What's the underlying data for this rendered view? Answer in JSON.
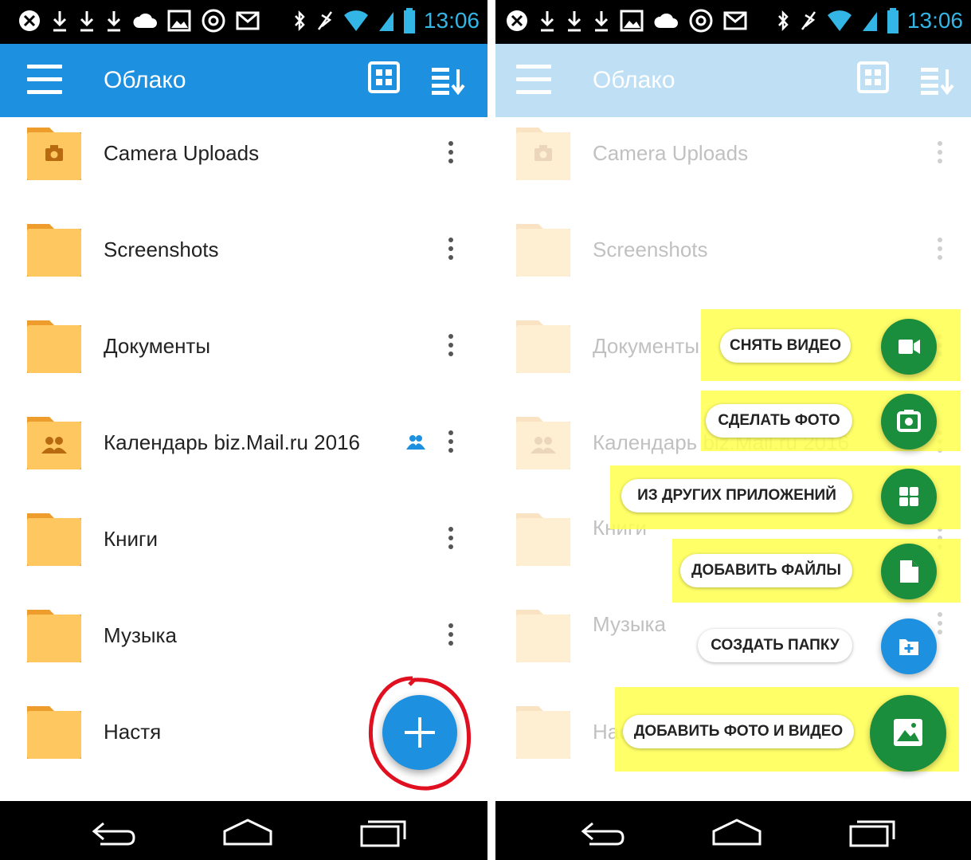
{
  "status_bar": {
    "time": "13:06"
  },
  "app_bar": {
    "title": "Облако"
  },
  "folders": [
    {
      "name": "Camera Uploads",
      "kind": "camera"
    },
    {
      "name": "Screenshots",
      "kind": "plain"
    },
    {
      "name": "Документы",
      "kind": "plain"
    },
    {
      "name": "Календарь biz.Mail.ru 2016",
      "kind": "shared"
    },
    {
      "name": "Книги",
      "kind": "plain"
    },
    {
      "name": "Музыка",
      "kind": "plain"
    },
    {
      "name": "Настя",
      "kind": "plain"
    }
  ],
  "fab_menu": {
    "record_video": "СНЯТЬ ВИДЕО",
    "take_photo": "СДЕЛАТЬ ФОТО",
    "from_other_apps": "ИЗ ДРУГИХ ПРИЛОЖЕНИЙ",
    "add_files": "ДОБАВИТЬ ФАЙЛЫ",
    "create_folder": "СОЗДАТЬ ПАПКУ",
    "add_photo_video": "ДОБАВИТЬ ФОТО И ВИДЕО"
  },
  "colors": {
    "accent": "#1e90e0",
    "fab_green": "#1b8e3e",
    "folder": "#fec760",
    "highlight": "#ffff4d",
    "fab_circle": "#e01020"
  }
}
